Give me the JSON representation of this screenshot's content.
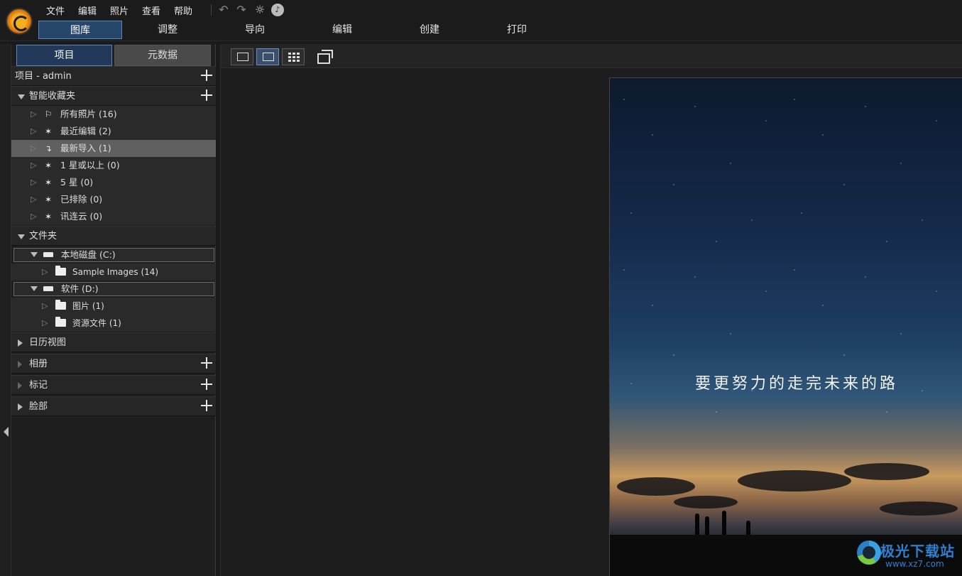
{
  "menu": {
    "items": [
      "文件",
      "编辑",
      "照片",
      "查看",
      "帮助"
    ]
  },
  "toolbar": {
    "undo_icon": "undo-icon",
    "redo_icon": "redo-icon",
    "settings_icon": "gear-icon",
    "notification_icon": "bell-icon"
  },
  "modules": {
    "tabs": [
      "图库",
      "调整",
      "导向",
      "编辑",
      "创建",
      "打印"
    ],
    "active": "图库"
  },
  "left_panel": {
    "tabs": [
      "项目",
      "元数据"
    ],
    "active_tab": "项目",
    "project_header": "项目 - admin",
    "smart_collections": {
      "title": "智能收藏夹",
      "items": [
        {
          "label": "所有照片 (16)",
          "icon": "hierarchy-icon"
        },
        {
          "label": "最近编辑 (2)",
          "icon": "magic-wand-icon"
        },
        {
          "label": "最新导入 (1)",
          "icon": "import-icon",
          "selected": true
        },
        {
          "label": "1 星或以上 (0)",
          "icon": "magic-wand-icon"
        },
        {
          "label": "5 星 (0)",
          "icon": "magic-wand-icon"
        },
        {
          "label": "已排除 (0)",
          "icon": "magic-wand-icon"
        },
        {
          "label": "讯连云 (0)",
          "icon": "magic-wand-icon"
        }
      ]
    },
    "folders": {
      "title": "文件夹",
      "drives": [
        {
          "label": "本地磁盘 (C:)",
          "children": [
            "Sample Images (14)"
          ]
        },
        {
          "label": "软件 (D:)",
          "children": [
            "图片 (1)",
            "资源文件 (1)"
          ]
        }
      ]
    },
    "calendar": {
      "title": "日历视图"
    },
    "albums": {
      "title": "相册"
    },
    "tags": {
      "title": "标记"
    },
    "faces": {
      "title": "脸部"
    }
  },
  "viewer": {
    "photo_caption": "要更努力的走完未来的路"
  },
  "watermark": {
    "title": "极光下载站",
    "url": "www.xz7.com"
  },
  "colors": {
    "accent": "#27466b",
    "accent_border": "#5a86b8",
    "selected_row": "#606060",
    "background": "#1a1a1a"
  }
}
